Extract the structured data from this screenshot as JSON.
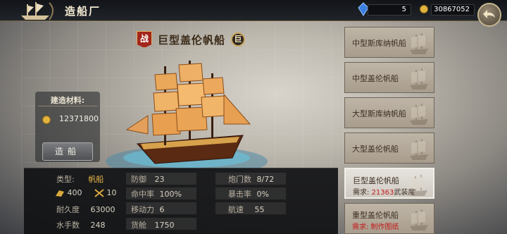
{
  "header": {
    "title": "造船厂",
    "gems": "5",
    "gold": "30867052"
  },
  "ship": {
    "war_badge": "战",
    "name": "巨型盖伦帆船",
    "size_badge": "巨"
  },
  "materials": {
    "title": "建造材料:",
    "coin_value": "12371800",
    "build_button": "造船"
  },
  "stats": {
    "type_label": "类型:",
    "type_value": "帆船",
    "sailors_icon_value": "400",
    "cannons_icon_value": "10",
    "durability_label": "耐久度",
    "durability_value": "63000",
    "crew_label": "水手数",
    "crew_value": "248",
    "defense_label": "防御",
    "defense_value": "23",
    "accuracy_label": "命中率",
    "accuracy_value": "100%",
    "mobility_label": "移动力",
    "mobility_value": "6",
    "cargo_label": "货舱",
    "cargo_value": "1750",
    "ports_label": "炮门数",
    "ports_value": "8/72",
    "crit_label": "暴击率",
    "crit_value": "0%",
    "speed_label": "航速",
    "speed_value": "55"
  },
  "ship_list": [
    {
      "name": "中型斯库纳帆船"
    },
    {
      "name": "中型盖伦帆船"
    },
    {
      "name": "大型斯库纳帆船"
    },
    {
      "name": "大型盖伦帆船"
    },
    {
      "name": "巨型盖伦帆船",
      "req_label": "需求:",
      "req_value": "21363",
      "req_unit": "武装度"
    },
    {
      "name": "重型盖伦帆船",
      "req_text": "需求: 制作图纸"
    }
  ],
  "colors": {
    "accent_gold": "#e8b54b",
    "requirement_red": "#c41a1a"
  },
  "icons": {
    "logo": "ship-logo-icon",
    "gem": "blue-gem-icon",
    "coin": "gold-coin-icon",
    "back": "back-arrow-icon",
    "sailor": "sailor-icon",
    "cannon": "crossed-swords-icon"
  }
}
